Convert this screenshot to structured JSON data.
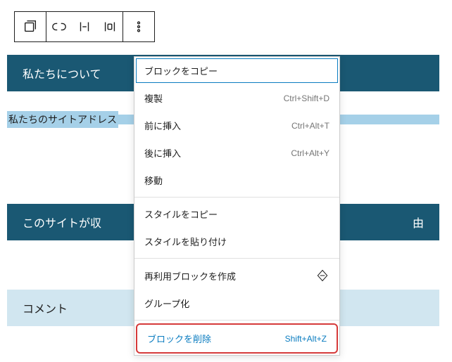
{
  "toolbar": {
    "icons": {
      "a": "columns-icon",
      "b": "link-icon",
      "c": "justify-icon",
      "d": "layout-icon",
      "e": "more-icon"
    }
  },
  "headings": {
    "about": "私たちについて",
    "address_selected": "私たちのサイトアドレス",
    "data": "このサイトが収",
    "data_suffix": "由",
    "comments": "コメント"
  },
  "menu": {
    "copy": "ブロックをコピー",
    "duplicate": {
      "label": "複製",
      "shortcut": "Ctrl+Shift+D"
    },
    "insert_before": {
      "label": "前に挿入",
      "shortcut": "Ctrl+Alt+T"
    },
    "insert_after": {
      "label": "後に挿入",
      "shortcut": "Ctrl+Alt+Y"
    },
    "move": "移動",
    "copy_styles": "スタイルをコピー",
    "paste_styles": "スタイルを貼り付け",
    "reusable": "再利用ブロックを作成",
    "group": "グループ化",
    "delete": {
      "label": "ブロックを削除",
      "shortcut": "Shift+Alt+Z"
    }
  }
}
